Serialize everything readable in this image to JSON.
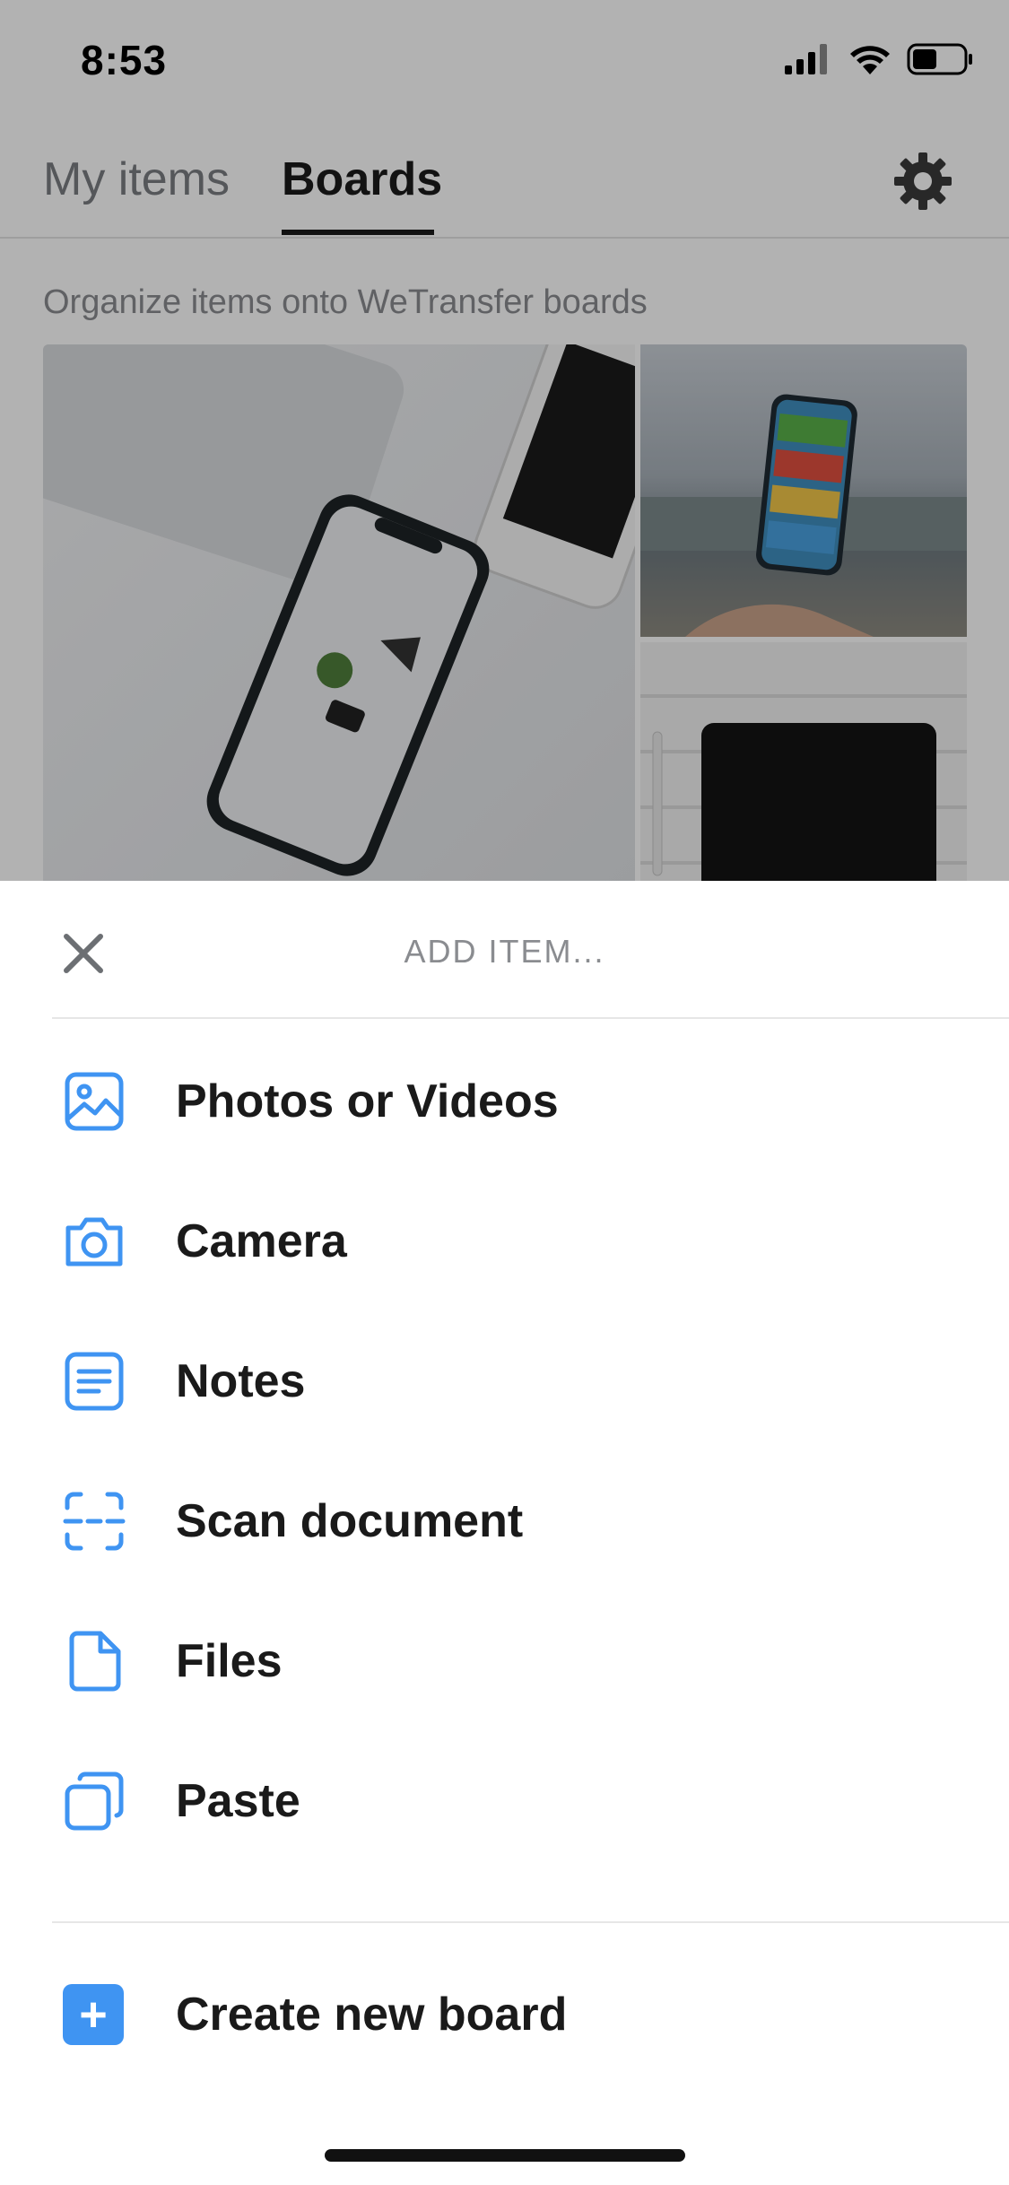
{
  "status_bar": {
    "time": "8:53",
    "icons": [
      "cellular-signal-icon",
      "wifi-icon",
      "battery-icon"
    ]
  },
  "tabs": [
    {
      "label": "My items",
      "selected": false
    },
    {
      "label": "Boards",
      "selected": true
    }
  ],
  "settings_icon": "gear-icon",
  "boards": {
    "subtitle": "Organize items onto WeTransfer boards"
  },
  "sheet": {
    "title": "ADD ITEM...",
    "close_icon": "close-icon",
    "items": [
      {
        "label": "Photos or Videos",
        "icon": "photo-icon"
      },
      {
        "label": "Camera",
        "icon": "camera-icon"
      },
      {
        "label": "Notes",
        "icon": "notes-icon"
      },
      {
        "label": "Scan document",
        "icon": "scan-icon"
      },
      {
        "label": "Files",
        "icon": "file-icon"
      },
      {
        "label": "Paste",
        "icon": "paste-icon"
      }
    ],
    "create_board": {
      "label": "Create new board",
      "icon": "plus-icon",
      "symbol": "+"
    }
  },
  "colors": {
    "accent": "#3f94f2",
    "text_primary": "#1a1a1a",
    "text_secondary": "#8a8c90"
  }
}
